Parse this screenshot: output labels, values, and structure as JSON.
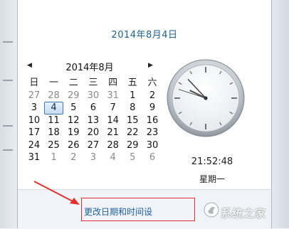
{
  "header": {
    "long_date": "2014年8月4日"
  },
  "calendar": {
    "month_title": "2014年8月",
    "prev_icon": "triangle-left-icon",
    "next_icon": "triangle-right-icon",
    "weekday_headers": [
      "日",
      "一",
      "二",
      "三",
      "四",
      "五",
      "六"
    ],
    "weeks": [
      [
        {
          "d": "27",
          "m": "prev"
        },
        {
          "d": "28",
          "m": "prev"
        },
        {
          "d": "29",
          "m": "prev"
        },
        {
          "d": "30",
          "m": "prev"
        },
        {
          "d": "31",
          "m": "prev"
        },
        {
          "d": "1",
          "m": "cur"
        },
        {
          "d": "2",
          "m": "cur"
        }
      ],
      [
        {
          "d": "3",
          "m": "cur"
        },
        {
          "d": "4",
          "m": "cur",
          "today": true
        },
        {
          "d": "5",
          "m": "cur"
        },
        {
          "d": "6",
          "m": "cur"
        },
        {
          "d": "7",
          "m": "cur"
        },
        {
          "d": "8",
          "m": "cur"
        },
        {
          "d": "9",
          "m": "cur"
        }
      ],
      [
        {
          "d": "10",
          "m": "cur"
        },
        {
          "d": "11",
          "m": "cur"
        },
        {
          "d": "12",
          "m": "cur"
        },
        {
          "d": "13",
          "m": "cur"
        },
        {
          "d": "14",
          "m": "cur"
        },
        {
          "d": "15",
          "m": "cur"
        },
        {
          "d": "16",
          "m": "cur"
        }
      ],
      [
        {
          "d": "17",
          "m": "cur"
        },
        {
          "d": "18",
          "m": "cur"
        },
        {
          "d": "19",
          "m": "cur"
        },
        {
          "d": "20",
          "m": "cur"
        },
        {
          "d": "21",
          "m": "cur"
        },
        {
          "d": "22",
          "m": "cur"
        },
        {
          "d": "23",
          "m": "cur"
        }
      ],
      [
        {
          "d": "24",
          "m": "cur"
        },
        {
          "d": "25",
          "m": "cur"
        },
        {
          "d": "26",
          "m": "cur"
        },
        {
          "d": "27",
          "m": "cur"
        },
        {
          "d": "28",
          "m": "cur"
        },
        {
          "d": "29",
          "m": "cur"
        },
        {
          "d": "30",
          "m": "cur"
        }
      ],
      [
        {
          "d": "31",
          "m": "cur"
        },
        {
          "d": "1",
          "m": "next"
        },
        {
          "d": "2",
          "m": "next"
        },
        {
          "d": "3",
          "m": "next"
        },
        {
          "d": "4",
          "m": "next"
        },
        {
          "d": "5",
          "m": "next"
        },
        {
          "d": "6",
          "m": "next"
        }
      ]
    ]
  },
  "clock": {
    "time_text": "21:52:48",
    "hour": 21,
    "minute": 52,
    "second": 48,
    "weekday": "星期一"
  },
  "footer": {
    "change_link": "更改日期和时间设"
  },
  "annotation": {
    "highlight_color": "#e2302d"
  },
  "watermark": {
    "text": "系统之家"
  },
  "colors": {
    "accent": "#1d5f8e",
    "link": "#1f5fa3",
    "today_border": "#3b77bb"
  }
}
